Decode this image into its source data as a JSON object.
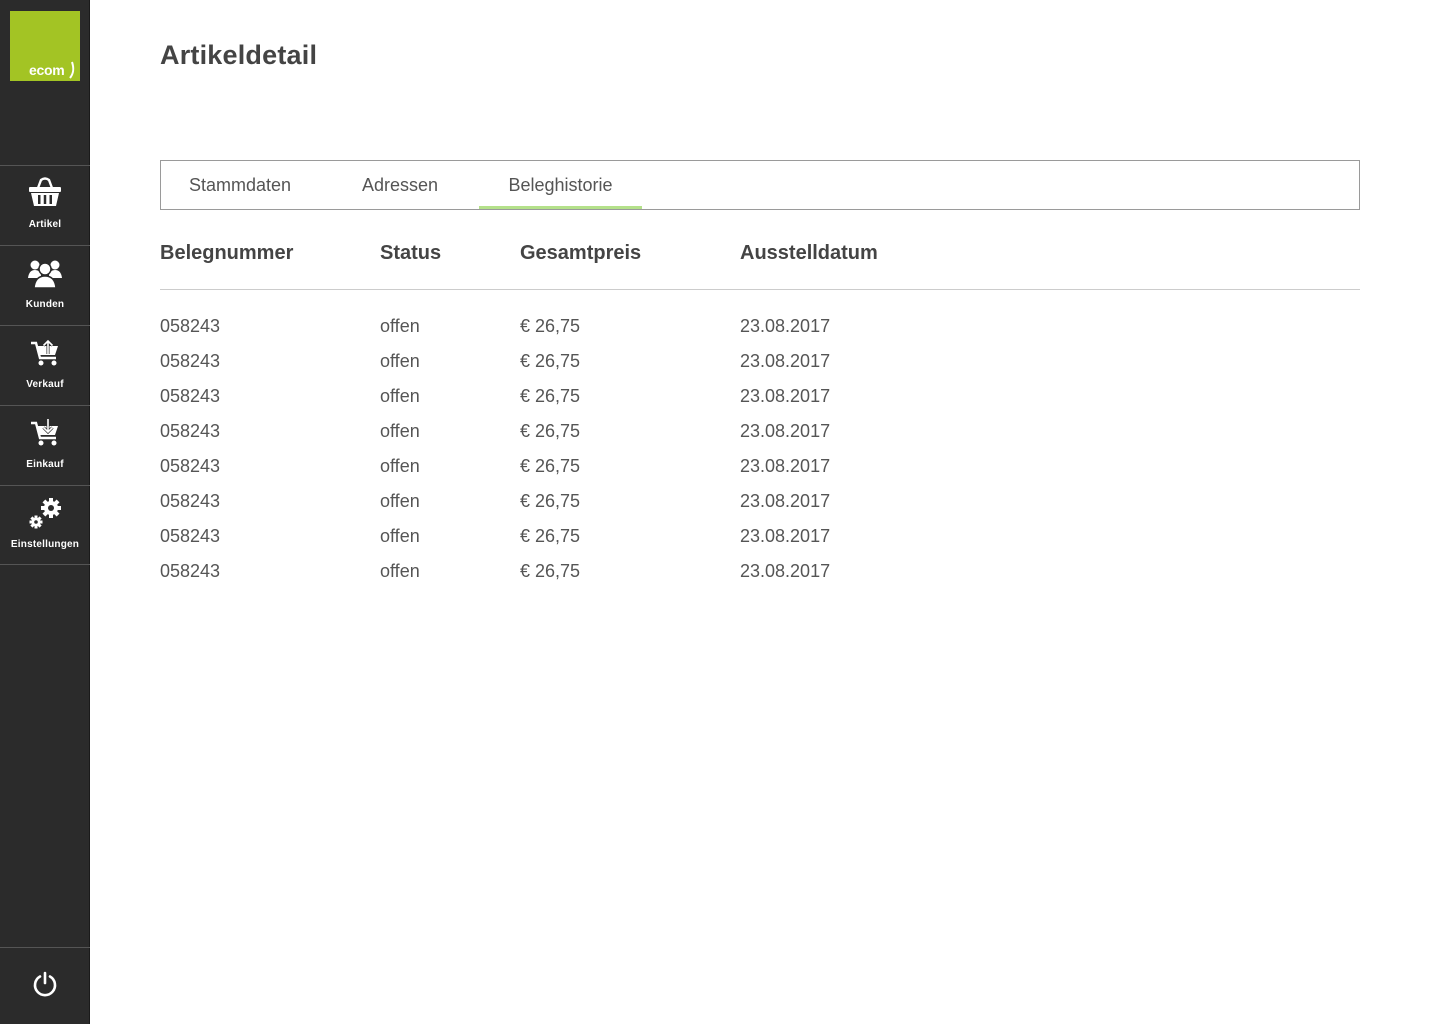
{
  "app": {
    "logo_text": "ecom",
    "brand_color": "#a3c424",
    "accent_color": "#b4e18a"
  },
  "sidebar": {
    "items": [
      {
        "label": "Artikel",
        "icon": "basket-icon"
      },
      {
        "label": "Kunden",
        "icon": "users-icon"
      },
      {
        "label": "Verkauf",
        "icon": "cart-upload-icon"
      },
      {
        "label": "Einkauf",
        "icon": "cart-download-icon"
      },
      {
        "label": "Einstellungen",
        "icon": "gears-icon"
      }
    ],
    "power_icon": "power-icon"
  },
  "page": {
    "title": "Artikeldetail"
  },
  "tabs": [
    {
      "label": "Stammdaten",
      "active": false
    },
    {
      "label": "Adressen",
      "active": false
    },
    {
      "label": "Beleghistorie",
      "active": true
    }
  ],
  "table": {
    "headers": [
      "Belegnummer",
      "Status",
      "Gesamtpreis",
      "Ausstelldatum"
    ],
    "rows": [
      [
        "058243",
        "offen",
        "€ 26,75",
        "23.08.2017"
      ],
      [
        "058243",
        "offen",
        "€ 26,75",
        "23.08.2017"
      ],
      [
        "058243",
        "offen",
        "€ 26,75",
        "23.08.2017"
      ],
      [
        "058243",
        "offen",
        "€ 26,75",
        "23.08.2017"
      ],
      [
        "058243",
        "offen",
        "€ 26,75",
        "23.08.2017"
      ],
      [
        "058243",
        "offen",
        "€ 26,75",
        "23.08.2017"
      ],
      [
        "058243",
        "offen",
        "€ 26,75",
        "23.08.2017"
      ],
      [
        "058243",
        "offen",
        "€ 26,75",
        "23.08.2017"
      ]
    ]
  }
}
